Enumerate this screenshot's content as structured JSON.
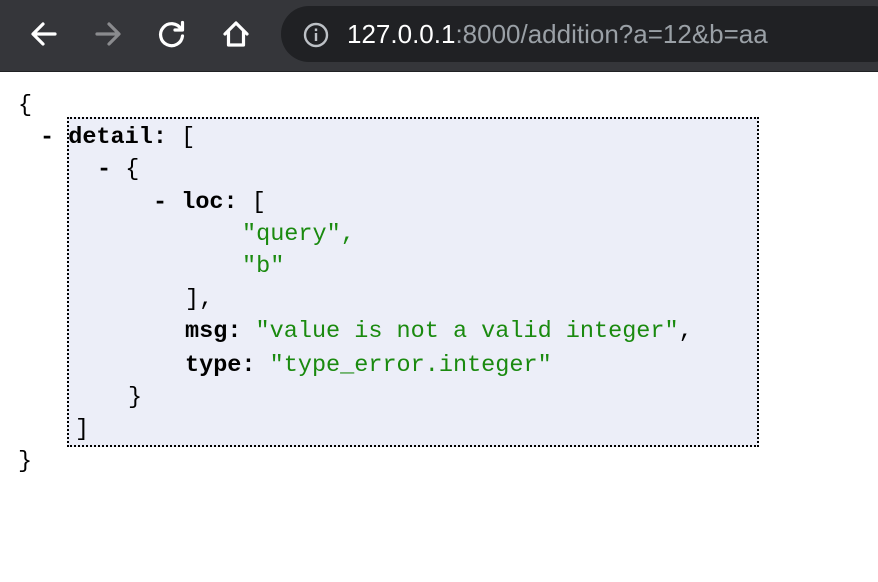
{
  "browser": {
    "url_host": "127.0.0.1",
    "url_rest": ":8000/addition?a=12&b=aa"
  },
  "json": {
    "open_root": "{",
    "close_root": "}",
    "collapse_marker": "-",
    "detail_key": "detail",
    "colon": ":",
    "open_array": "[",
    "close_array": "]",
    "open_obj": "{",
    "close_obj": "}",
    "loc_key": "loc",
    "loc_values": [
      "\"query\",",
      "\"b\""
    ],
    "loc_close": "],",
    "msg_key": "msg",
    "msg_value": "\"value is not a valid integer\"",
    "comma": ",",
    "type_key": "type",
    "type_value": "\"type_error.integer\""
  },
  "colors": {
    "toolbar_bg": "#35363a",
    "omnibox_bg": "#202124",
    "string_green": "#1a8a0f",
    "hover_bg": "#eceef8"
  }
}
